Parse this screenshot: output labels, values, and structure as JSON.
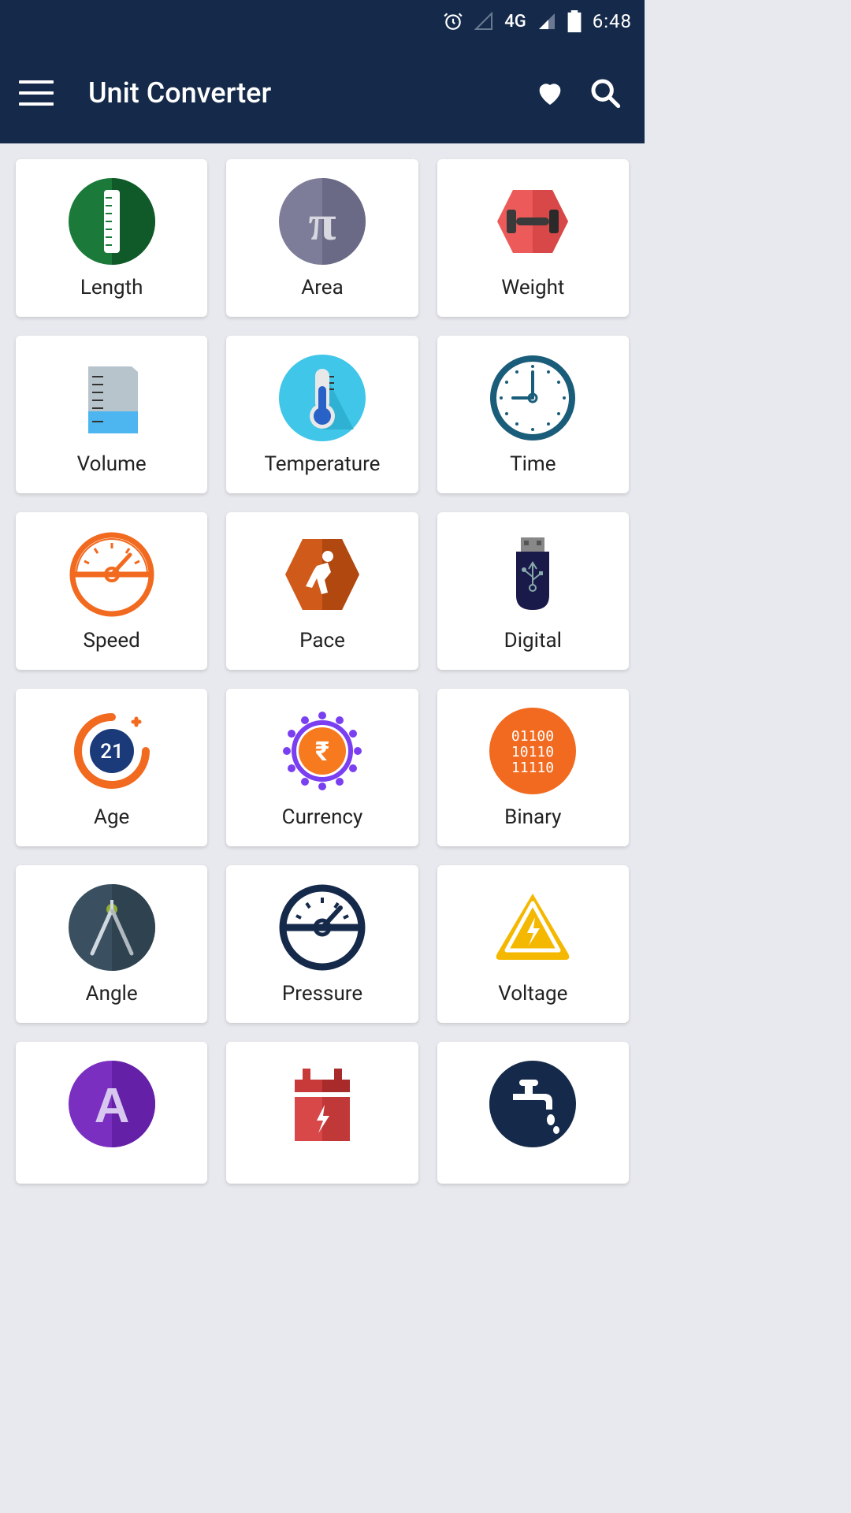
{
  "statusbar": {
    "network_label": "4G",
    "time": "6:48"
  },
  "appbar": {
    "title": "Unit Converter"
  },
  "categories": [
    {
      "id": "length",
      "label": "Length"
    },
    {
      "id": "area",
      "label": "Area"
    },
    {
      "id": "weight",
      "label": "Weight"
    },
    {
      "id": "volume",
      "label": "Volume"
    },
    {
      "id": "temperature",
      "label": "Temperature"
    },
    {
      "id": "time",
      "label": "Time"
    },
    {
      "id": "speed",
      "label": "Speed"
    },
    {
      "id": "pace",
      "label": "Pace"
    },
    {
      "id": "digital",
      "label": "Digital"
    },
    {
      "id": "age",
      "label": "Age"
    },
    {
      "id": "currency",
      "label": "Currency"
    },
    {
      "id": "binary",
      "label": "Binary"
    },
    {
      "id": "angle",
      "label": "Angle"
    },
    {
      "id": "pressure",
      "label": "Pressure"
    },
    {
      "id": "voltage",
      "label": "Voltage"
    },
    {
      "id": "ampere",
      "label": ""
    },
    {
      "id": "power",
      "label": ""
    },
    {
      "id": "flow",
      "label": ""
    }
  ],
  "colors": {
    "primary": "#152a4a",
    "background": "#e8e9ee"
  }
}
